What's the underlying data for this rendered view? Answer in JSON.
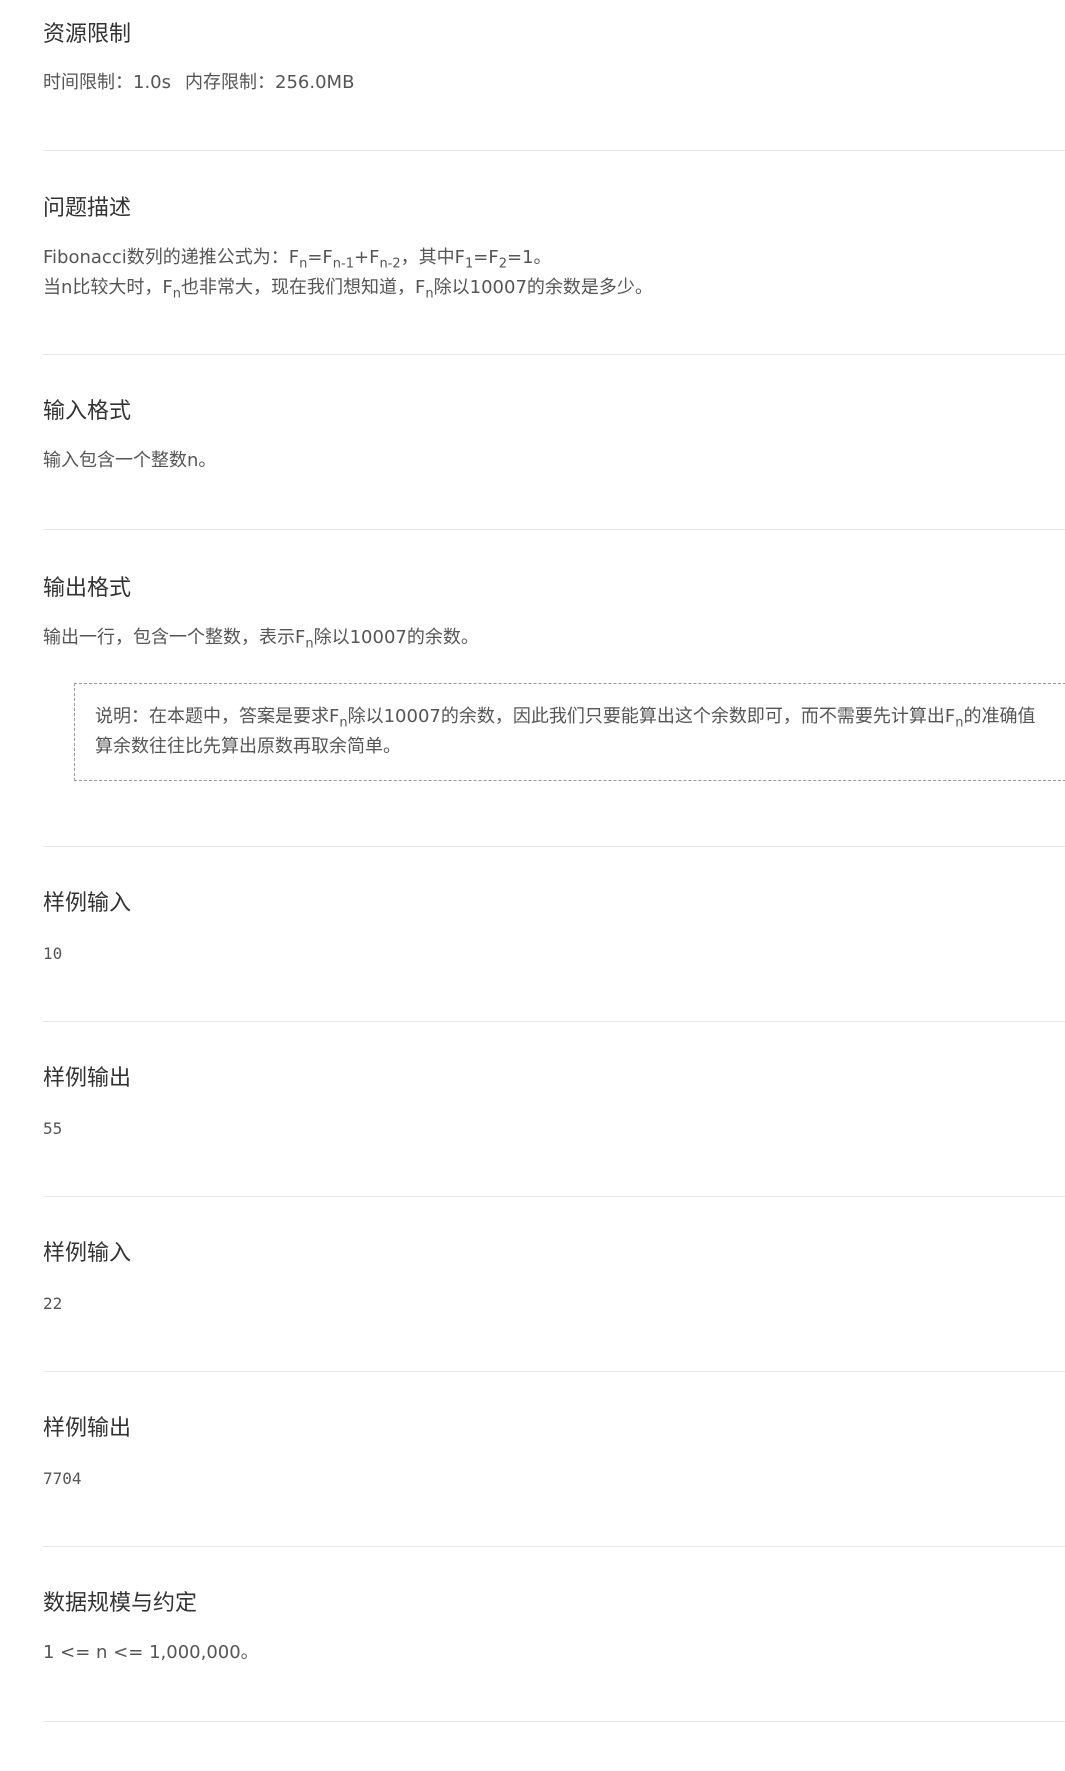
{
  "resource": {
    "title": "资源限制",
    "time_label": "时间限制：",
    "time_value": "1.0s",
    "memory_label": "内存限制：",
    "memory_value": "256.0MB"
  },
  "description": {
    "title": "问题描述",
    "line1_prefix": "Fibonacci数列的递推公式为：",
    "F": "F",
    "sub_n": "n",
    "sub_n1": "n-1",
    "sub_n2": "n-2",
    "sub_1": "1",
    "sub_2": "2",
    "eq": "=",
    "plus": "+",
    "line1_mid": "，其中",
    "line1_end": "=1。",
    "line2_a": "当n比较大时，",
    "line2_b": "也非常大，现在我们想知道，",
    "line2_c": "除以10007的余数是多少。"
  },
  "input_format": {
    "title": "输入格式",
    "text": "输入包含一个整数n。"
  },
  "output_format": {
    "title": "输出格式",
    "text_a": "输出一行，包含一个整数，表示",
    "text_b": "除以10007的余数。",
    "note_a": "说明：在本题中，答案是要求",
    "note_b": "除以10007的余数，因此我们只要能算出这个余数即可，而不需要先计算出",
    "note_c": "的准确值",
    "note_line2": "算余数往往比先算出原数再取余简单。"
  },
  "samples": [
    {
      "title": "样例输入",
      "value": "10"
    },
    {
      "title": "样例输出",
      "value": "55"
    },
    {
      "title": "样例输入",
      "value": "22"
    },
    {
      "title": "样例输出",
      "value": "7704"
    }
  ],
  "constraints": {
    "title": "数据规模与约定",
    "text": "1 <= n <= 1,000,000。"
  }
}
